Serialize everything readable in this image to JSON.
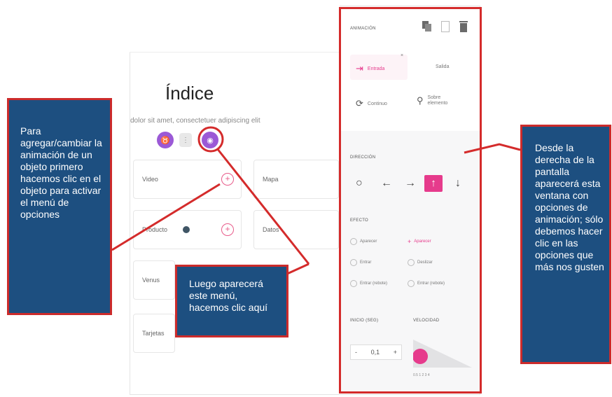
{
  "page": {
    "title": "Índice",
    "lorem": "dolor sit amet, consectetuer adipiscing elit"
  },
  "toolbar": {
    "btn1_icon": "♉",
    "btn2_icon": "⋮",
    "btn3_icon": "◉"
  },
  "cards": [
    {
      "label": "Video"
    },
    {
      "label": "Mapa"
    },
    {
      "label": "Producto"
    },
    {
      "label": "Datos"
    },
    {
      "label": "Venus"
    },
    {
      "label": "Tarjetas"
    }
  ],
  "panel": {
    "header": "ANIMACIÓN",
    "anim_options": [
      "Entrada",
      "Salida",
      "Continuo",
      "Sobre elemento"
    ],
    "direction_label": "DIRECCIÓN",
    "effect_label": "EFECTO",
    "effects_left": [
      "Aparecer",
      "Entrar",
      "Entrar (rebote)"
    ],
    "effects_right": [
      "Aparecer",
      "Deslizar",
      "Entrar (rebote)"
    ],
    "start_label": "INICIO (seg)",
    "speed_label": "VELOCIDAD",
    "start_value": "0,1",
    "minus": "-",
    "plus": "+"
  },
  "callouts": {
    "left": "Para agregar/cambiar la animación de un objeto primero hacemos clic en el objeto para activar el menú de opciones",
    "middle": "Luego aparecerá este menú, hacemos clic aquí",
    "right": "Desde la derecha de la pantalla aparecerá esta ventana con opciones de animación; sólo debemos hacer clic en las opciones que más nos gusten"
  },
  "colors": {
    "callout_bg": "#1d4f80",
    "callout_border": "#cc2b2b",
    "accent_pink": "#e63b8c",
    "accent_purple": "#9b59d6"
  }
}
